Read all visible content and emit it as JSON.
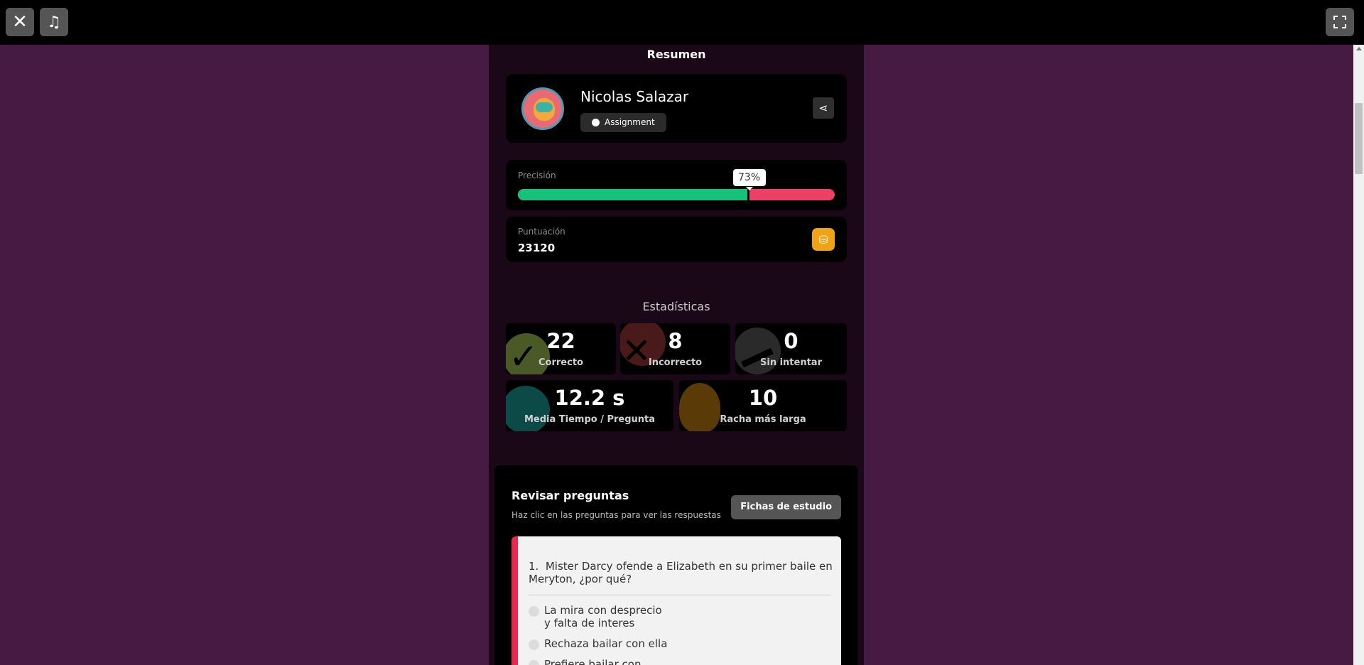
{
  "topbar": {
    "close_icon": "close-icon",
    "music_icon": "music-icon",
    "fullscreen_icon": "fullscreen-icon"
  },
  "summary": {
    "title": "Resumen"
  },
  "user": {
    "name": "Nicolas Salazar",
    "badge": "Assignment",
    "share_icon": "share-icon"
  },
  "accuracy": {
    "label": "Precisión",
    "value_label": "73%",
    "fraction": 0.73,
    "correct_color": "#16c27b",
    "incorrect_color": "#ec4065"
  },
  "score": {
    "label": "Puntuación",
    "value": "23120"
  },
  "stats": {
    "title": "Estadísticas",
    "correct": {
      "value": "22",
      "label": "Correcto"
    },
    "incorrect": {
      "value": "8",
      "label": "Incorrecto"
    },
    "unattempted": {
      "value": "0",
      "label": "Sin intentar"
    },
    "avg_time": {
      "value": "12.2 s",
      "label": "Media Tiempo / Pregunta"
    },
    "streak": {
      "value": "10",
      "label": "Racha más larga"
    }
  },
  "review": {
    "title": "Revisar preguntas",
    "subtitle": "Haz clic en las preguntas para ver las respuestas",
    "flashcards_label": "Fichas de estudio",
    "question": {
      "number": "1.",
      "text": "Mister Darcy ofende a Elizabeth en su primer baile en Meryton, ¿por qué?",
      "options": [
        "La mira con desprecio y falta de interes",
        "Rechaza bailar con ella",
        "Prefiere bailar con otras"
      ]
    }
  }
}
